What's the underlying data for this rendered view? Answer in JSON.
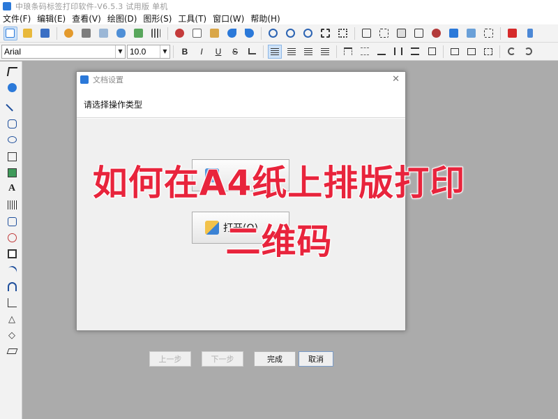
{
  "app": {
    "title": "中琅条码标签打印软件-V6.5.3 试用版 单机"
  },
  "menu": {
    "items": [
      "文件(F)",
      "编辑(E)",
      "查看(V)",
      "绘图(D)",
      "图形(S)",
      "工具(T)",
      "窗口(W)",
      "帮助(H)"
    ]
  },
  "toolbar": {
    "font_name": "Arial",
    "font_size": "10.0",
    "bold": "B",
    "italic": "I",
    "underline": "U",
    "strike": "S"
  },
  "dialog": {
    "title": "文档设置",
    "close": "✕",
    "prompt": "请选择操作类型",
    "open_label": "打开(O)",
    "prev": "上一步",
    "next": "下一步",
    "finish": "完成",
    "cancel": "取消"
  },
  "overlay": {
    "line1": "如何在A4纸上排版打印",
    "line2": "二维码"
  },
  "colors": {
    "caption": "#e8243c",
    "accent": "#2b79d9"
  }
}
